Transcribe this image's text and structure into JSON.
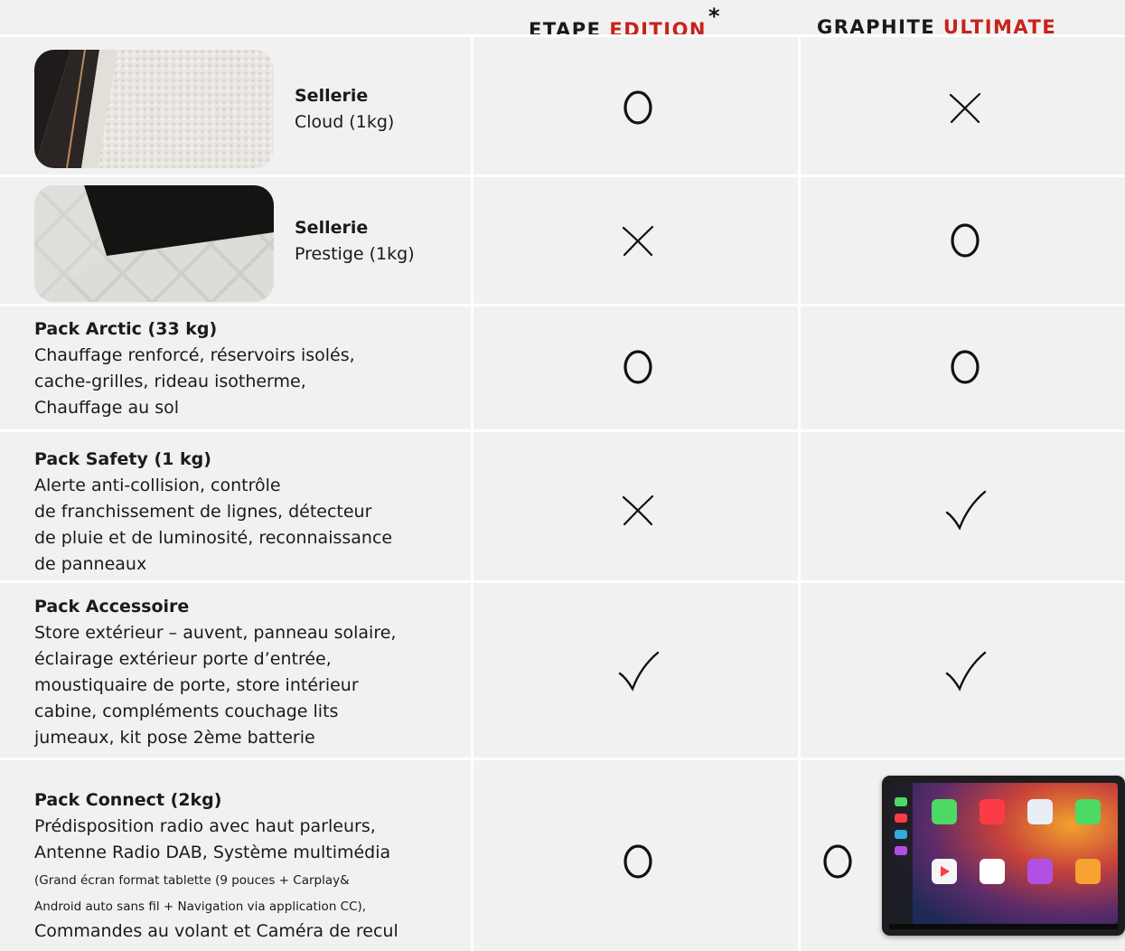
{
  "header": {
    "etape": {
      "word": "ETAPE",
      "accent": "EDITION",
      "star": "*"
    },
    "graphite": {
      "word": "GRAPHITE",
      "accent": "ULTIMATE"
    }
  },
  "legend_marks": {
    "optional": "O",
    "not_available": "x-mark",
    "standard": "check-mark"
  },
  "rows": [
    {
      "title": "Sellerie",
      "desc": "Cloud (1kg)",
      "etape": "O",
      "graphite": "x-mark"
    },
    {
      "title": "Sellerie",
      "desc": "Prestige (1kg)",
      "etape": "x-mark",
      "graphite": "O"
    },
    {
      "title": "Pack Arctic (33 kg)",
      "lines": [
        "Chauffage renforcé, réservoirs isolés,",
        "cache-grilles, rideau isotherme,",
        "Chauffage au sol"
      ],
      "etape": "O",
      "graphite": "O"
    },
    {
      "title": "Pack Safety (1 kg)",
      "lines": [
        "Alerte anti-collision, contrôle",
        "de franchissement de lignes, détecteur",
        "de pluie et de luminosité, reconnaissance",
        "de panneaux"
      ],
      "etape": "x-mark",
      "graphite": "check-mark"
    },
    {
      "title": "Pack Accessoire",
      "lines": [
        "Store extérieur – auvent, panneau solaire,",
        "éclairage extérieur porte d’entrée,",
        "moustiquaire de porte, store intérieur",
        "cabine, compléments couchage lits",
        "jumeaux, kit pose 2ème batterie"
      ],
      "etape": "check-mark",
      "graphite": "check-mark"
    },
    {
      "title": "Pack Connect (2kg)",
      "lines": [
        "Prédisposition radio avec haut parleurs,",
        "Antenne Radio DAB, Système multimédia"
      ],
      "small_lines": [
        "(Grand écran format tablette (9 pouces + Carplay&",
        "Android auto sans fil + Navigation via application CC),"
      ],
      "last_line": "Commandes au volant et Caméra de recul",
      "etape": "O",
      "graphite": "O"
    }
  ],
  "colors": {
    "accent": "#c8211b",
    "background": "#f1f1f1",
    "grid": "#ffffff"
  }
}
